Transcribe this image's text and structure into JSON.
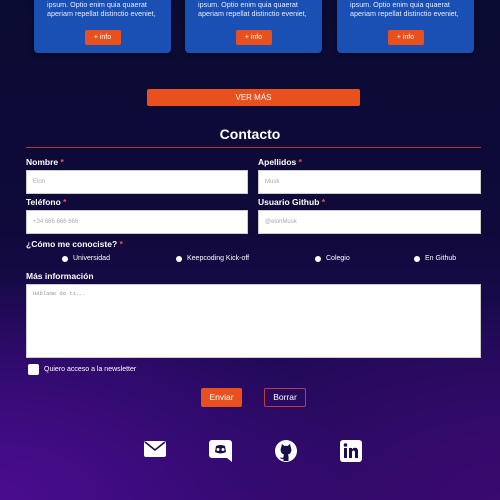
{
  "cards": [
    {
      "text": "ipsum. Optio enim quia quaerat aperiam repellat distinctio eveniet,",
      "button": "+ info"
    },
    {
      "text": "ipsum. Optio enim quia quaerat aperiam repellat distinctio eveniet,",
      "button": "+ info"
    },
    {
      "text": "ipsum. Optio enim quia quaerat aperiam repellat distinctio eveniet,",
      "button": "+ info"
    }
  ],
  "ver_mas": "VER MÁS",
  "contact": {
    "title": "Contacto",
    "nombre": {
      "label": "Nombre",
      "required": "*",
      "placeholder": "Elon"
    },
    "apellidos": {
      "label": "Apellidos",
      "required": "*",
      "placeholder": "Musk"
    },
    "telefono": {
      "label": "Teléfono",
      "required": "*",
      "placeholder": "+34 666 666 666"
    },
    "github": {
      "label": "Usuario Github",
      "required": "*",
      "placeholder": "@elonMusk"
    },
    "how": {
      "label": "¿Cómo me conociste?",
      "required": "*"
    },
    "options": [
      "Universidad",
      "Keepcoding Kick-off",
      "Colegio",
      "En Github"
    ],
    "more_info": {
      "label": "Más información",
      "placeholder": "Háblame de ti..."
    },
    "newsletter": "Quiero acceso a la newsletter",
    "send": "Enviar",
    "clear": "Borrar"
  },
  "social_icons": [
    "email-icon",
    "discord-icon",
    "github-icon",
    "linkedin-icon"
  ],
  "colors": {
    "accent": "#e8501e",
    "card": "#1a4fb3",
    "required": "#ff4d4d"
  }
}
